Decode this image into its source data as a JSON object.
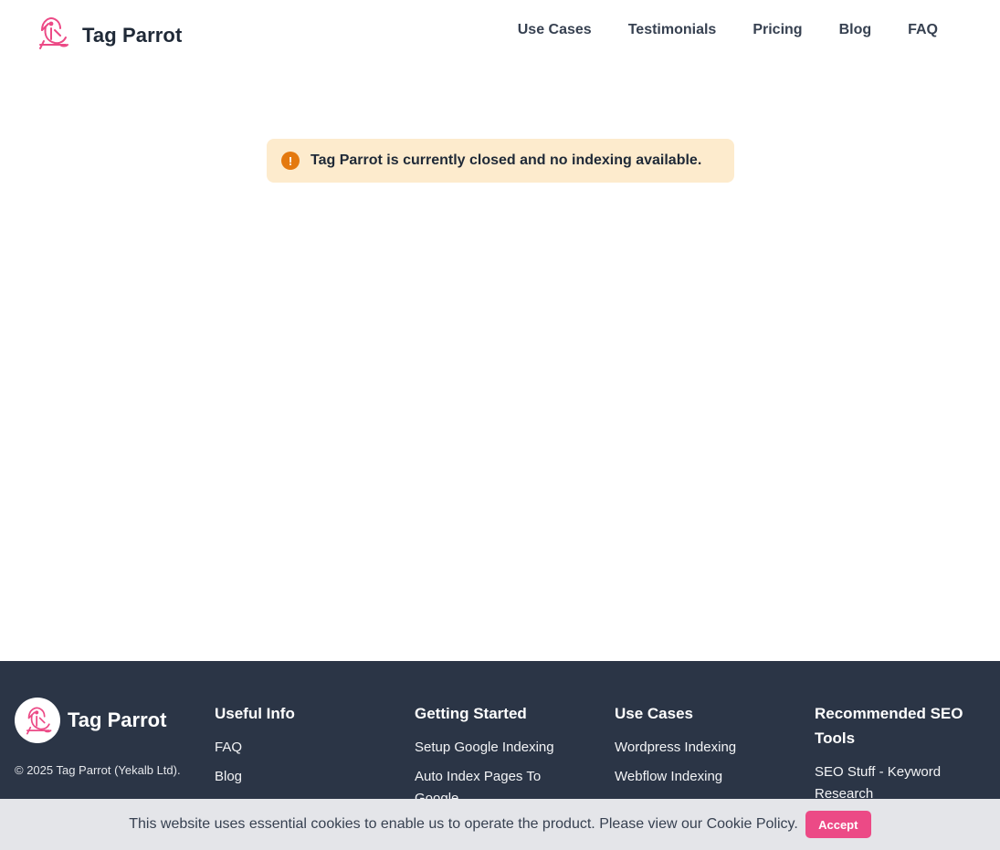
{
  "header": {
    "brand": "Tag Parrot",
    "logo_icon": "parrot-icon",
    "nav": [
      "Use Cases",
      "Testimonials",
      "Pricing",
      "Blog",
      "FAQ"
    ]
  },
  "alert": {
    "icon": "exclamation-icon",
    "text": "Tag Parrot is currently closed and no indexing available."
  },
  "footer": {
    "brand": "Tag Parrot",
    "copyright": "© 2025 Tag Parrot (Yekalb Ltd).",
    "columns": [
      {
        "title": "Useful Info",
        "links": [
          "FAQ",
          "Blog"
        ]
      },
      {
        "title": "Getting Started",
        "links": [
          "Setup Google Indexing",
          "Auto Index Pages To Google"
        ]
      },
      {
        "title": "Use Cases",
        "links": [
          "Wordpress Indexing",
          "Webflow Indexing"
        ]
      },
      {
        "title": "Recommended SEO Tools",
        "links": [
          "SEO Stuff - Keyword Research"
        ]
      }
    ]
  },
  "cookie": {
    "text": "This website uses essential cookies to enable us to operate the product. Please view our ",
    "link": "Cookie Policy",
    "suffix": ".",
    "accept_label": "Accept"
  },
  "colors": {
    "brand_pink": "#ec4a86",
    "footer_bg": "#2b3546",
    "alert_bg": "#fdebcd",
    "alert_icon": "#e4790f"
  }
}
